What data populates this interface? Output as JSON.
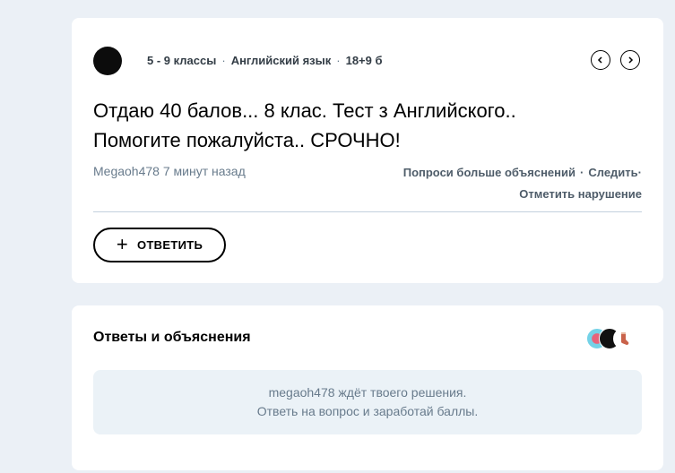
{
  "question": {
    "grade": "5 - 9 классы",
    "subject": "Английский язык",
    "points": "18+9 б",
    "text_line1": "Отдаю 40 балов... 8 клас. Тест з Английского..",
    "text_line2": "Помогите пожалуйста.. СРОЧНО!",
    "author": "Megaoh478",
    "time": "7 минут назад",
    "actions": {
      "ask_more": "Попроси больше объяснений",
      "follow": "Следить",
      "report": "Отметить нарушение"
    },
    "answer_button": "ОТВЕТИТЬ",
    "prev_icon": "chevron-left-icon",
    "next_icon": "chevron-right-icon"
  },
  "answers": {
    "title": "Ответы и объяснения",
    "empty_line1": "megaoh478 ждёт твоего решения.",
    "empty_line2": "Ответь на вопрос и заработай баллы."
  },
  "colors": {
    "page_bg": "#ebf0f6",
    "card_bg": "#ffffff",
    "muted_text": "#687b8c",
    "divider": "#c3d1dd"
  }
}
